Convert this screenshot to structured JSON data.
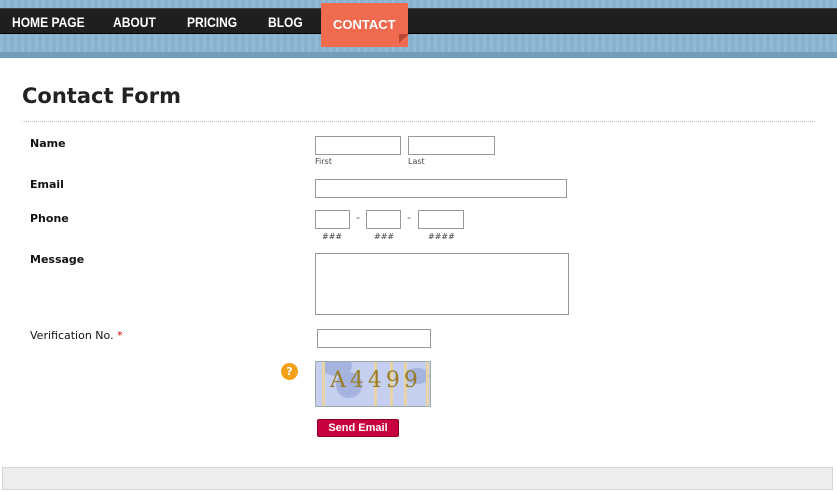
{
  "nav": {
    "items": [
      {
        "label": "HOME PAGE"
      },
      {
        "label": "ABOUT"
      },
      {
        "label": "PRICING"
      },
      {
        "label": "BLOG"
      },
      {
        "label": "CONTACT"
      }
    ],
    "active": "CONTACT",
    "active_color": "#f06a50"
  },
  "form": {
    "title": "Contact Form",
    "name_label": "Name",
    "name_first_sub": "First",
    "name_last_sub": "Last",
    "email_label": "Email",
    "phone_label": "Phone",
    "phone_sep": "-",
    "phone_sub_1": "###",
    "phone_sub_2": "###",
    "phone_sub_3": "####",
    "message_label": "Message",
    "verification_label": "Verification No.",
    "required_mark": "*",
    "help_icon": "?",
    "captcha_code": "A4499",
    "send_label": "Send Email",
    "send_color": "#c8003f"
  }
}
